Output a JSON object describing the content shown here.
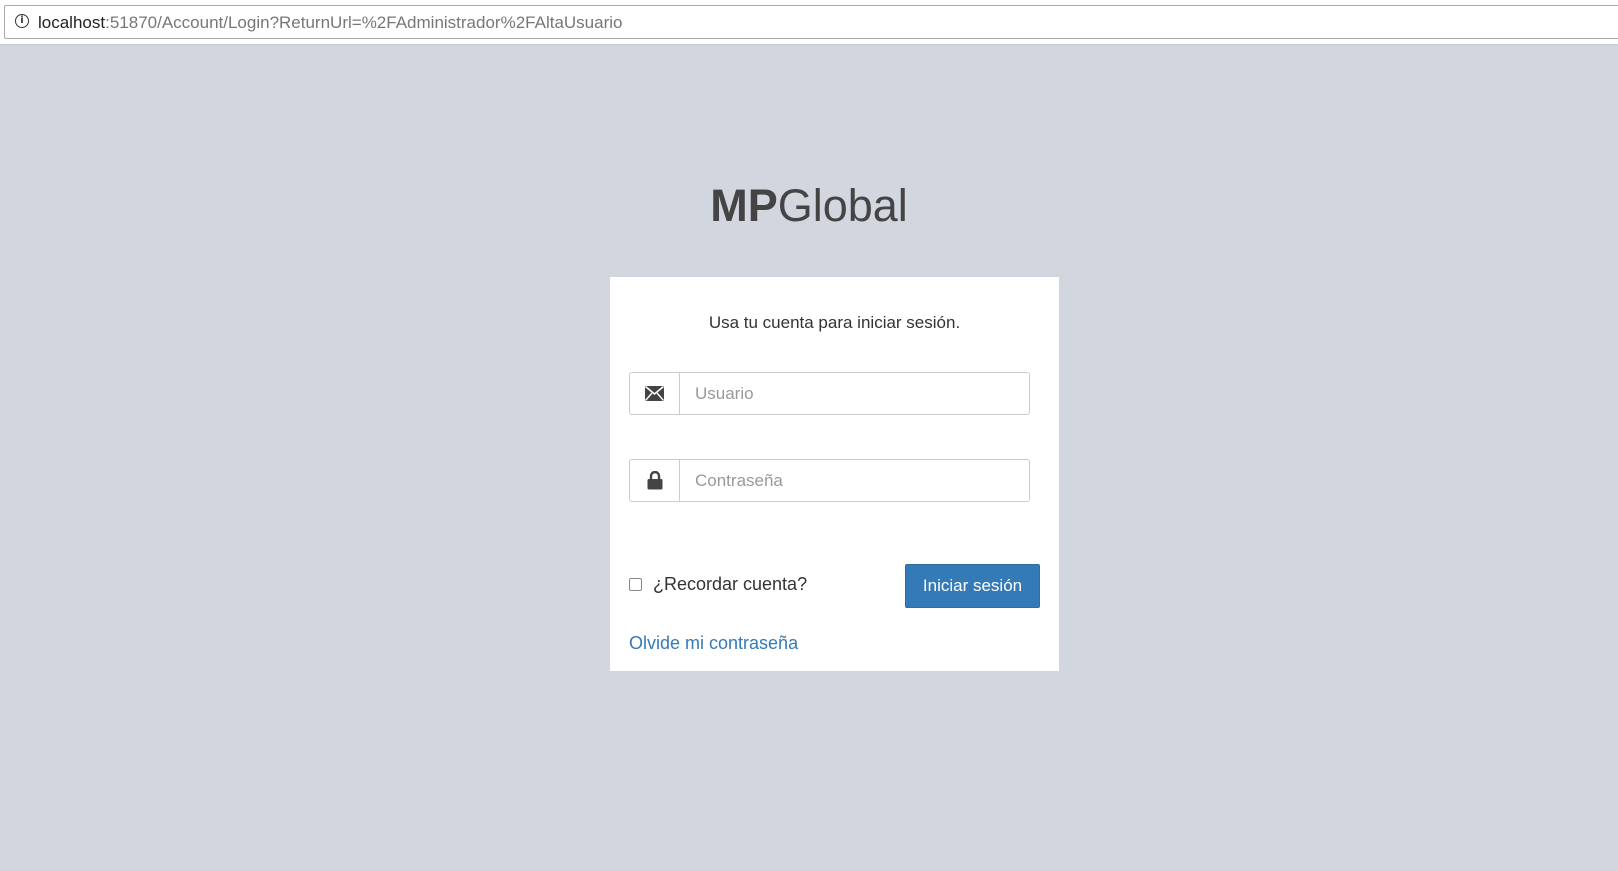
{
  "browser": {
    "url_host": "localhost",
    "url_rest": ":51870/Account/Login?ReturnUrl=%2FAdministrador%2FAltaUsuario",
    "info_icon": "info-icon"
  },
  "logo": {
    "bold": "MP",
    "regular": "Global"
  },
  "login": {
    "message": "Usa tu cuenta para iniciar sesión.",
    "user_icon": "envelope-icon",
    "user_placeholder": "Usuario",
    "user_value": "",
    "password_icon": "lock-icon",
    "password_placeholder": "Contraseña",
    "password_value": "",
    "remember_label": "¿Recordar cuenta?",
    "remember_checked": false,
    "submit_label": "Iniciar sesión",
    "forgot_label": "Olvide mi contraseña"
  },
  "colors": {
    "background": "#d2d6de",
    "primary": "#337ab7",
    "box": "#ffffff"
  }
}
